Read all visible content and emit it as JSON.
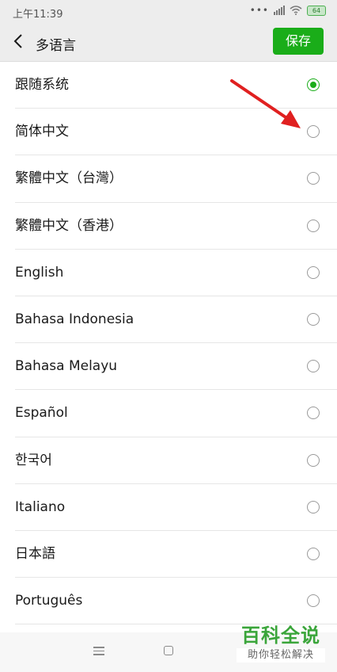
{
  "status_bar": {
    "time": "上午11:39",
    "battery": "64"
  },
  "header": {
    "title": "多语言",
    "save_label": "保存"
  },
  "languages": [
    {
      "label": "跟随系统",
      "selected": true
    },
    {
      "label": "简体中文",
      "selected": false
    },
    {
      "label": "繁體中文（台灣）",
      "selected": false
    },
    {
      "label": "繁體中文（香港）",
      "selected": false
    },
    {
      "label": "English",
      "selected": false
    },
    {
      "label": "Bahasa Indonesia",
      "selected": false
    },
    {
      "label": "Bahasa Melayu",
      "selected": false
    },
    {
      "label": "Español",
      "selected": false
    },
    {
      "label": "한국어",
      "selected": false
    },
    {
      "label": "Italiano",
      "selected": false
    },
    {
      "label": "日本語",
      "selected": false
    },
    {
      "label": "Português",
      "selected": false
    }
  ],
  "watermark": {
    "main": "百科全说",
    "sub": "助你轻松解决"
  },
  "colors": {
    "accent": "#1aad19",
    "annotation_arrow": "#e02020",
    "watermark": "#3aa53a"
  }
}
